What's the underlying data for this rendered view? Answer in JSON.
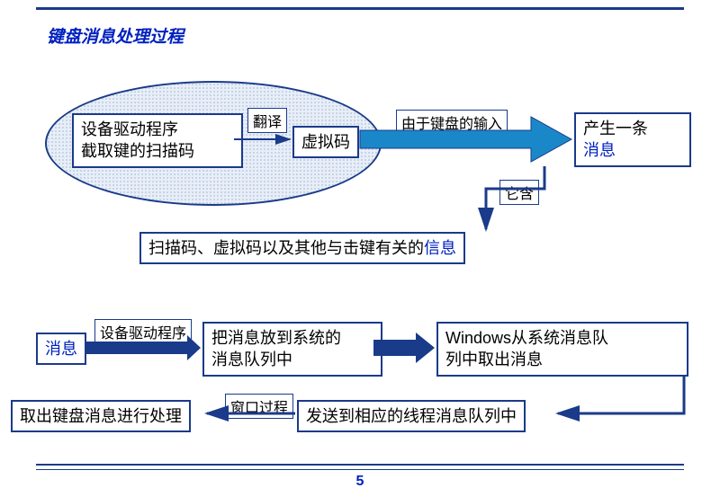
{
  "title": "键盘消息处理过程",
  "ellipse_box": "设备驱动程序\n截取键的扫描码",
  "translate_label": "翻译",
  "virtual_code": "虚拟码",
  "keyboard_input_label": "由于键盘的输入",
  "produce_msg_line1": "产生一条",
  "produce_msg_line2": "消息",
  "contains_label": "它含",
  "info_box_plain": "扫描码、虚拟码以及其他与击键有关的",
  "info_box_blue": "信息",
  "msg_word": "消息",
  "driver_label": "设备驱动程序",
  "queue_box": "把消息放到系统的\n消息队列中",
  "windows_box": "Windows从系统消息队\n列中取出消息",
  "thread_queue_box": "发送到相应的线程消息队列中",
  "winproc_label": "窗口过程",
  "process_box": "取出键盘消息进行处理",
  "page": "5"
}
